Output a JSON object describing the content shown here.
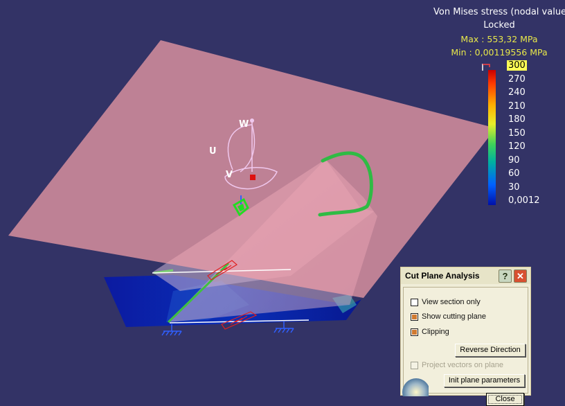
{
  "legend": {
    "title": "Von Mises stress (nodal values",
    "status": "Locked",
    "max": "Max : 553,32 MPa",
    "min": "Min : 0,00119556 MPa",
    "ticks": [
      "300",
      "270",
      "240",
      "210",
      "180",
      "150",
      "120",
      "90",
      "60",
      "30",
      "0,0012"
    ],
    "highlight_color": "#ffff55"
  },
  "compass": {
    "axis_w": "W",
    "axis_u": "U",
    "axis_v": "V"
  },
  "dialog": {
    "title": "Cut Plane Analysis",
    "help_label": "?",
    "close_x": "✕",
    "options": [
      {
        "label": "View section only",
        "checked": false,
        "enabled": true
      },
      {
        "label": "Show cutting plane",
        "checked": true,
        "enabled": true
      },
      {
        "label": "Clipping",
        "checked": true,
        "enabled": true
      },
      {
        "label": "Project vectors on plane",
        "checked": false,
        "enabled": false
      }
    ],
    "reverse_label": "Reverse Direction",
    "init_label": "Init plane parameters",
    "close_label": "Close"
  },
  "colors": {
    "background": "#333366",
    "cut_plane": "#f4a0a8",
    "accent_checkbox": "#d07a30",
    "legend_minmax": "#e8e84a"
  }
}
